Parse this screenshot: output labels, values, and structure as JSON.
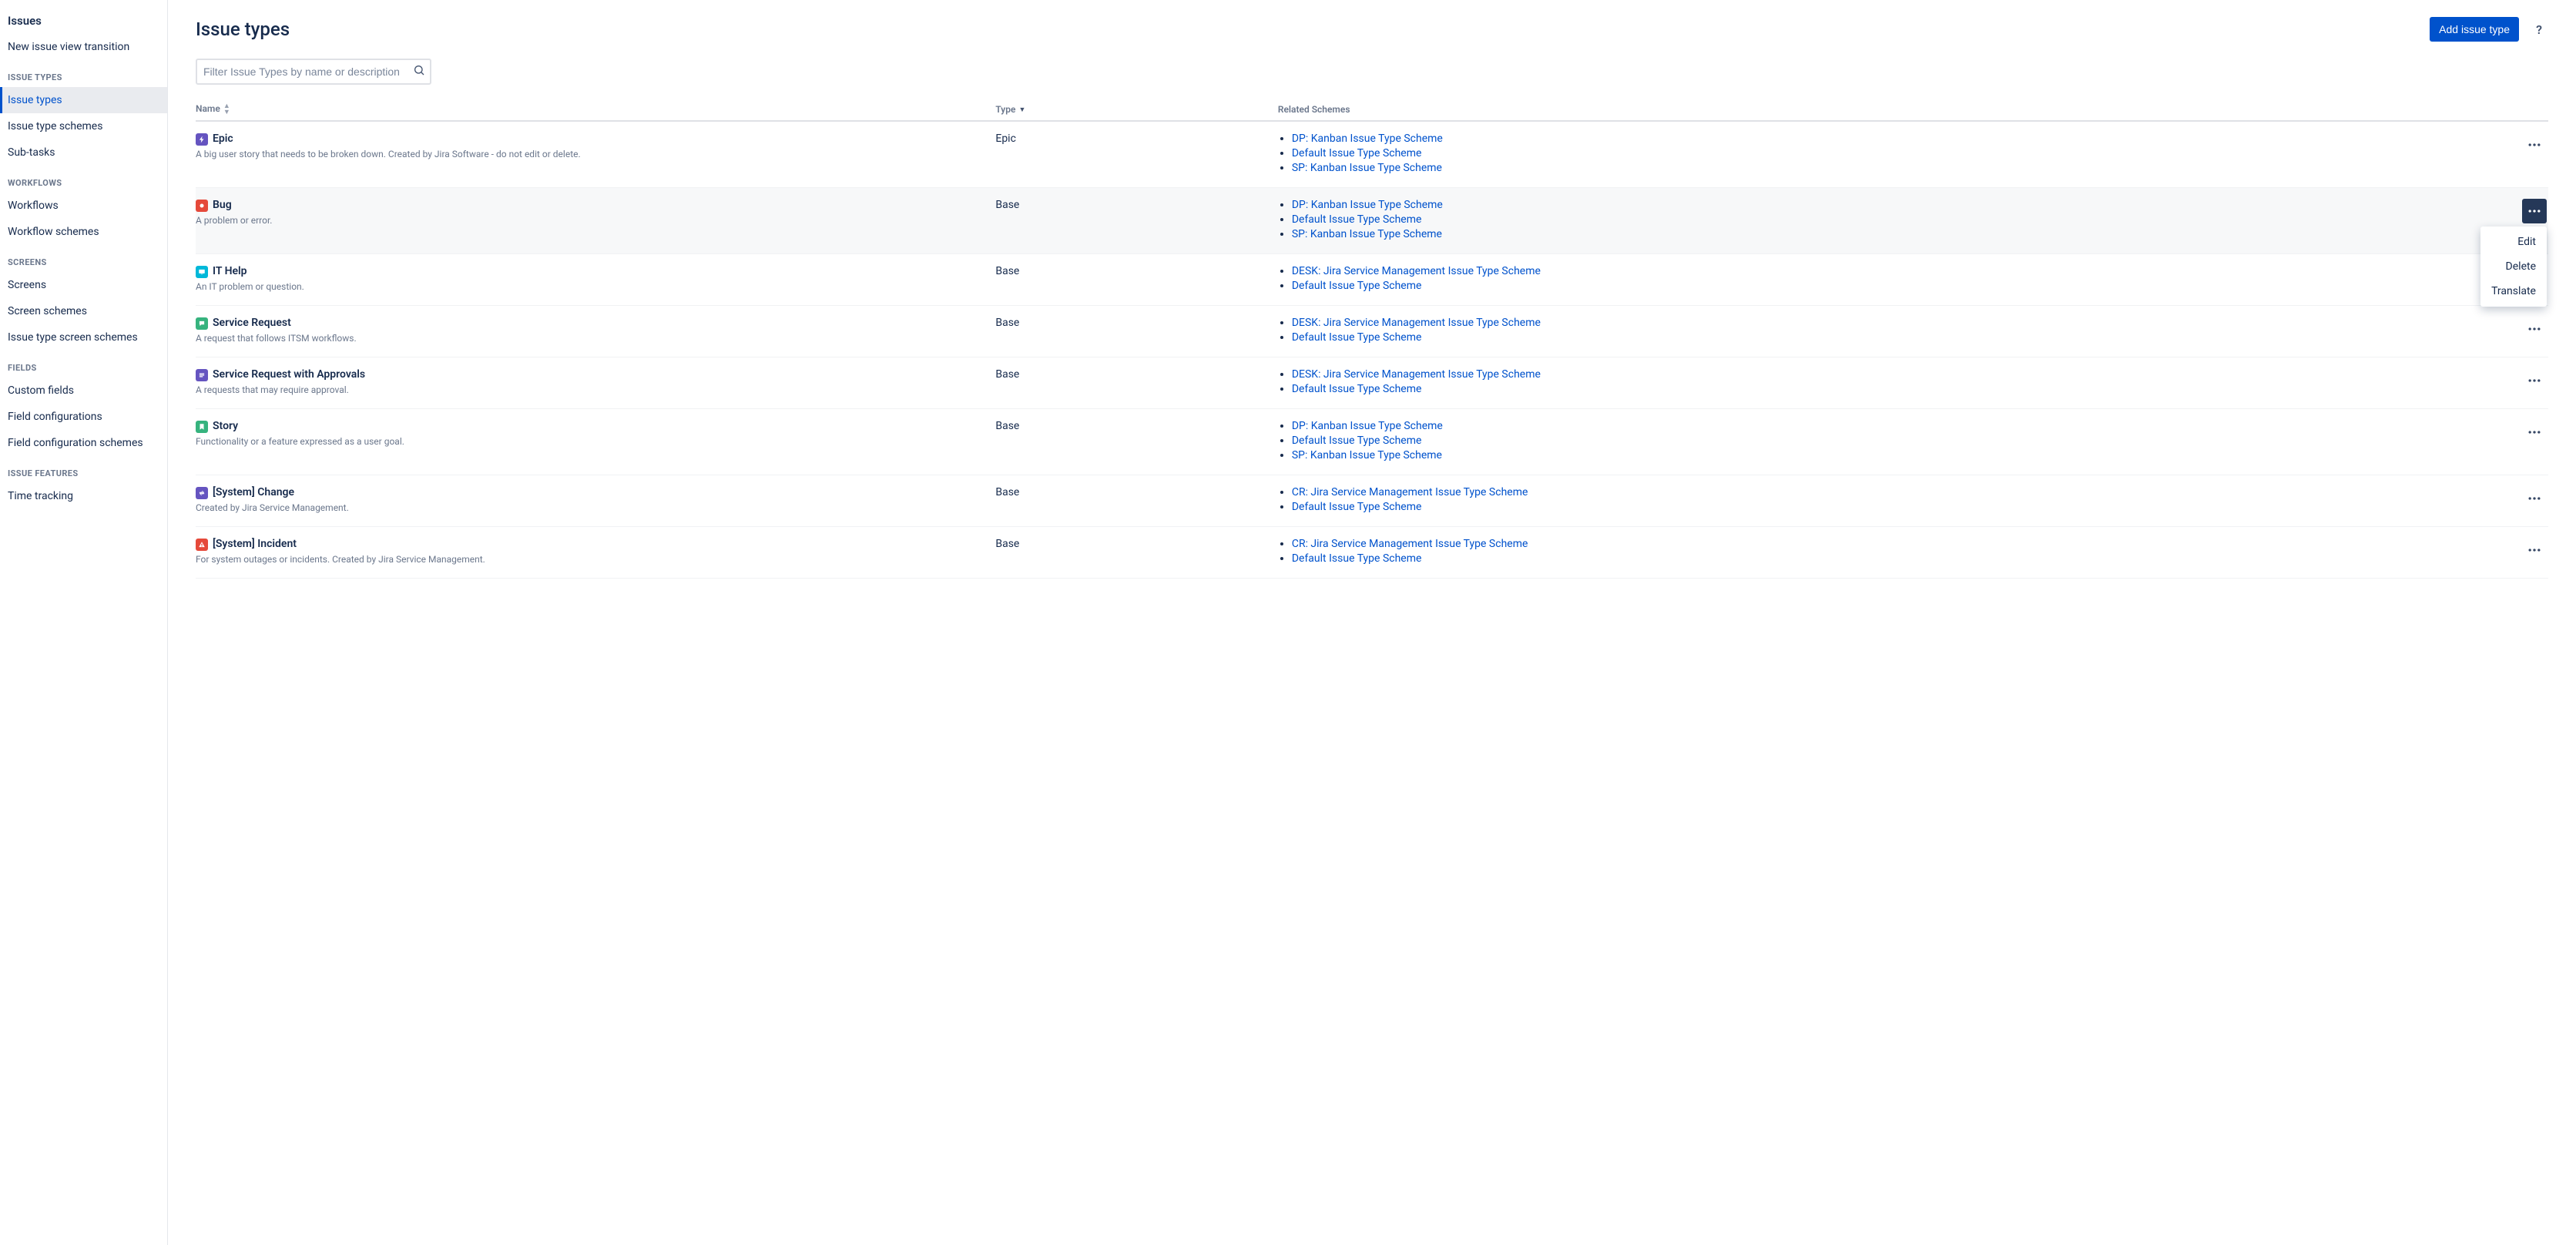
{
  "sidebar": {
    "heading": "Issues",
    "topItem": "New issue view transition",
    "groups": [
      {
        "label": "Issue types",
        "items": [
          "Issue types",
          "Issue type schemes",
          "Sub-tasks"
        ],
        "activeIndex": 0
      },
      {
        "label": "Workflows",
        "items": [
          "Workflows",
          "Workflow schemes"
        ]
      },
      {
        "label": "Screens",
        "items": [
          "Screens",
          "Screen schemes",
          "Issue type screen schemes"
        ]
      },
      {
        "label": "Fields",
        "items": [
          "Custom fields",
          "Field configurations",
          "Field configuration schemes"
        ]
      },
      {
        "label": "Issue features",
        "items": [
          "Time tracking"
        ]
      }
    ]
  },
  "header": {
    "title": "Issue types",
    "addButton": "Add issue type",
    "helpTooltip": "?"
  },
  "search": {
    "placeholder": "Filter Issue Types by name or description"
  },
  "table": {
    "columns": [
      "Name",
      "Type",
      "Related Schemes"
    ],
    "rows": [
      {
        "icon": {
          "bg": "#6554C0",
          "glyph": "bolt"
        },
        "name": "Epic",
        "desc": "A big user story that needs to be broken down. Created by Jira Software - do not edit or delete.",
        "type": "Epic",
        "schemes": [
          "DP: Kanban Issue Type Scheme",
          "Default Issue Type Scheme",
          "SP: Kanban Issue Type Scheme"
        ],
        "menuOpen": false
      },
      {
        "icon": {
          "bg": "#E5493A",
          "glyph": "dot"
        },
        "name": "Bug",
        "desc": "A problem or error.",
        "type": "Base",
        "schemes": [
          "DP: Kanban Issue Type Scheme",
          "Default Issue Type Scheme",
          "SP: Kanban Issue Type Scheme"
        ],
        "menuOpen": true,
        "hovered": true
      },
      {
        "icon": {
          "bg": "#00B8D9",
          "glyph": "screen"
        },
        "name": "IT Help",
        "desc": "An IT problem or question.",
        "type": "Base",
        "schemes": [
          "DESK: Jira Service Management Issue Type Scheme",
          "Default Issue Type Scheme"
        ],
        "menuOpen": false
      },
      {
        "icon": {
          "bg": "#36B37E",
          "glyph": "bubble"
        },
        "name": "Service Request",
        "desc": "A request that follows ITSM workflows.",
        "type": "Base",
        "schemes": [
          "DESK: Jira Service Management Issue Type Scheme",
          "Default Issue Type Scheme"
        ],
        "menuOpen": false
      },
      {
        "icon": {
          "bg": "#6554C0",
          "glyph": "lines"
        },
        "name": "Service Request with Approvals",
        "desc": "A requests that may require approval.",
        "type": "Base",
        "schemes": [
          "DESK: Jira Service Management Issue Type Scheme",
          "Default Issue Type Scheme"
        ],
        "menuOpen": false
      },
      {
        "icon": {
          "bg": "#36B37E",
          "glyph": "bookmark"
        },
        "name": "Story",
        "desc": "Functionality or a feature expressed as a user goal.",
        "type": "Base",
        "schemes": [
          "DP: Kanban Issue Type Scheme",
          "Default Issue Type Scheme",
          "SP: Kanban Issue Type Scheme"
        ],
        "menuOpen": false
      },
      {
        "icon": {
          "bg": "#6554C0",
          "glyph": "arrows"
        },
        "name": "[System] Change",
        "desc": "Created by Jira Service Management.",
        "type": "Base",
        "schemes": [
          "CR: Jira Service Management Issue Type Scheme",
          "Default Issue Type Scheme"
        ],
        "menuOpen": false
      },
      {
        "icon": {
          "bg": "#E5493A",
          "glyph": "alert"
        },
        "name": "[System] Incident",
        "desc": "For system outages or incidents. Created by Jira Service Management.",
        "type": "Base",
        "schemes": [
          "CR: Jira Service Management Issue Type Scheme",
          "Default Issue Type Scheme"
        ],
        "menuOpen": false
      }
    ]
  },
  "menu": {
    "items": [
      "Edit",
      "Delete",
      "Translate"
    ]
  }
}
